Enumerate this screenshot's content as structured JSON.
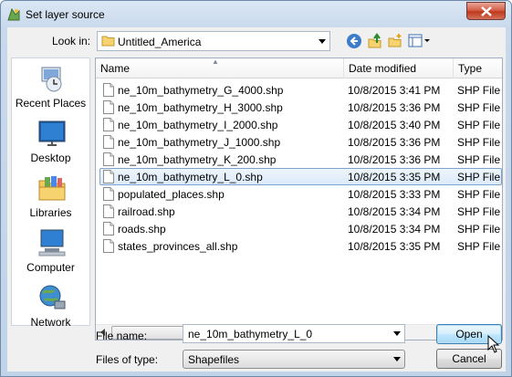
{
  "window": {
    "title": "Set layer source"
  },
  "lookin": {
    "label": "Look in:",
    "value": "Untitled_America"
  },
  "places": [
    {
      "label": "Recent Places",
      "icon": "recent-places-icon"
    },
    {
      "label": "Desktop",
      "icon": "desktop-icon"
    },
    {
      "label": "Libraries",
      "icon": "libraries-icon"
    },
    {
      "label": "Computer",
      "icon": "computer-icon"
    },
    {
      "label": "Network",
      "icon": "network-icon"
    }
  ],
  "columns": {
    "name": "Name",
    "date": "Date modified",
    "type": "Type"
  },
  "files": [
    {
      "name": "ne_10m_bathymetry_G_4000.shp",
      "date": "10/8/2015 3:41 PM",
      "type": "SHP File"
    },
    {
      "name": "ne_10m_bathymetry_H_3000.shp",
      "date": "10/8/2015 3:36 PM",
      "type": "SHP File"
    },
    {
      "name": "ne_10m_bathymetry_I_2000.shp",
      "date": "10/8/2015 3:40 PM",
      "type": "SHP File"
    },
    {
      "name": "ne_10m_bathymetry_J_1000.shp",
      "date": "10/8/2015 3:36 PM",
      "type": "SHP File"
    },
    {
      "name": "ne_10m_bathymetry_K_200.shp",
      "date": "10/8/2015 3:36 PM",
      "type": "SHP File"
    },
    {
      "name": "ne_10m_bathymetry_L_0.shp",
      "date": "10/8/2015 3:35 PM",
      "type": "SHP File",
      "selected": true
    },
    {
      "name": "populated_places.shp",
      "date": "10/8/2015 3:33 PM",
      "type": "SHP File"
    },
    {
      "name": "railroad.shp",
      "date": "10/8/2015 3:34 PM",
      "type": "SHP File"
    },
    {
      "name": "roads.shp",
      "date": "10/8/2015 3:34 PM",
      "type": "SHP File"
    },
    {
      "name": "states_provinces_all.shp",
      "date": "10/8/2015 3:35 PM",
      "type": "SHP File"
    }
  ],
  "filename": {
    "label": "File name:",
    "value": "ne_10m_bathymetry_L_0"
  },
  "filetype": {
    "label": "Files of type:",
    "value": "Shapefiles"
  },
  "buttons": {
    "open": "Open",
    "cancel": "Cancel"
  },
  "colors": {
    "selection": "#dbeaf9",
    "accent": "#3c7fb1",
    "close": "#c0391c"
  }
}
